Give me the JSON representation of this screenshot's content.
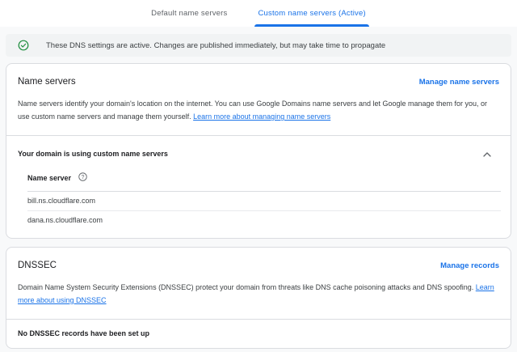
{
  "tabs": {
    "items": [
      {
        "label": "Default name servers",
        "active": false
      },
      {
        "label": "Custom name servers (Active)",
        "active": true
      }
    ]
  },
  "banner": {
    "icon": "check-circle-icon",
    "message": "These DNS settings are active. Changes are published immediately, but may take time to propagate"
  },
  "cards": {
    "name_servers": {
      "title": "Name servers",
      "action_label": "Manage name servers",
      "description": "Name servers identify your domain's location on the internet. You can use Google Domains name servers and let Google manage them for you, or use custom name servers and manage them yourself.",
      "learn_more_label": "Learn more about managing name servers",
      "section_title": "Your domain is using custom name servers",
      "collapse_icon": "chevron-up-icon",
      "table": {
        "header": "Name server",
        "header_icon": "help-icon",
        "rows": [
          "bill.ns.cloudflare.com",
          "dana.ns.cloudflare.com"
        ]
      }
    },
    "dnssec": {
      "title": "DNSSEC",
      "action_label": "Manage records",
      "description": "Domain Name System Security Extensions (DNSSEC) protect your domain from threats like DNS cache poisoning attacks and DNS spoofing.",
      "learn_more_label": "Learn more about using DNSSEC",
      "empty_state": "No DNSSEC records have been set up"
    }
  },
  "colors": {
    "accent_blue": "#1a73e8",
    "success_green": "#1e8e3e",
    "banner_bg": "#f1f3f4",
    "card_border": "#dadce0",
    "page_bg": "#f8f9fa",
    "text_primary": "#202124",
    "text_secondary": "#3c4043",
    "text_muted": "#5f6368"
  }
}
